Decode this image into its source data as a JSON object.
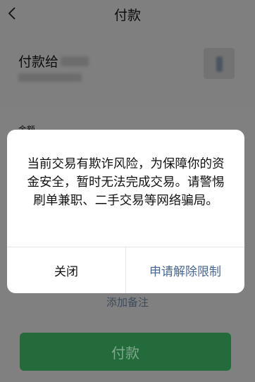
{
  "header": {
    "title": "付款"
  },
  "payee": {
    "label": "付款给"
  },
  "form": {
    "amount_label": "金额"
  },
  "remark": {
    "link_text": "添加备注"
  },
  "pay_button": {
    "label": "付款"
  },
  "dialog": {
    "message": "当前交易有欺诈风险，为保障你的资金安全，暂时无法完成交易。请警惕刷单兼职、二手交易等网络骗局。",
    "close_label": "关闭",
    "appeal_label": "申请解除限制"
  },
  "colors": {
    "pay_green": "#07c160",
    "link_blue": "#576b95",
    "overlay": "rgba(0,0,0,0.5)"
  }
}
